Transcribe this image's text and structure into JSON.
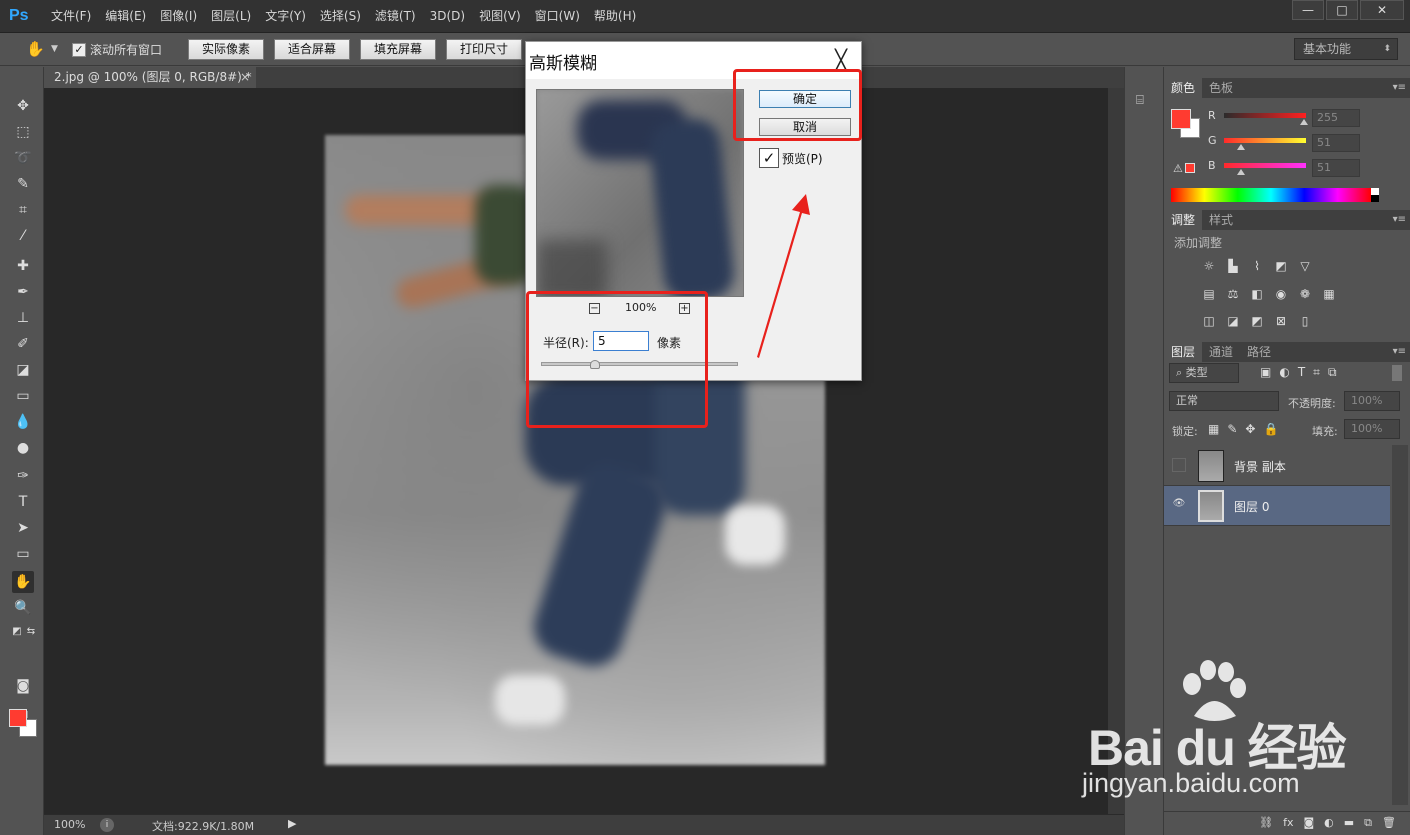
{
  "app": {
    "logo": "Ps",
    "menu": [
      "文件(F)",
      "编辑(E)",
      "图像(I)",
      "图层(L)",
      "文字(Y)",
      "选择(S)",
      "滤镜(T)",
      "3D(D)",
      "视图(V)",
      "窗口(W)",
      "帮助(H)"
    ],
    "window_controls": {
      "minimize": "—",
      "maximize": "□",
      "close": "✕"
    }
  },
  "options_bar": {
    "scroll_all_windows_label": "滚动所有窗口",
    "scroll_all_checked": true,
    "buttons": [
      "实际像素",
      "适合屏幕",
      "填充屏幕",
      "打印尺寸"
    ],
    "workspace": "基本功能"
  },
  "document": {
    "tab_title": "2.jpg @ 100% (图层 0, RGB/8#) *",
    "tab_close": "×",
    "zoom": "100%",
    "doc_info": "文档:922.9K/1.80M",
    "status_arrow": "▶"
  },
  "toolbar": {
    "icons": [
      "move-icon",
      "marquee-icon",
      "lasso-icon",
      "quick-select-icon",
      "crop-icon",
      "eyedropper-icon",
      "healing-brush-icon",
      "brush-icon",
      "clone-stamp-icon",
      "history-brush-icon",
      "eraser-icon",
      "gradient-icon",
      "blur-icon",
      "dodge-icon",
      "pen-icon",
      "type-icon",
      "path-select-icon",
      "rectangle-icon",
      "hand-icon",
      "zoom-icon"
    ],
    "active": "hand-icon",
    "foreground_color": "#ff3b30",
    "background_color": "#ffffff"
  },
  "color_panel": {
    "tabs": [
      "颜色",
      "色板"
    ],
    "r": {
      "label": "R",
      "value": "255"
    },
    "g": {
      "label": "G",
      "value": "51"
    },
    "b": {
      "label": "B",
      "value": "51"
    }
  },
  "adjustments_panel": {
    "tabs": [
      "调整",
      "样式"
    ],
    "add_label": "添加调整"
  },
  "layers_panel": {
    "tabs": [
      "图层",
      "通道",
      "路径"
    ],
    "filter_kind": "类型",
    "blend_mode": "正常",
    "opacity_label": "不透明度:",
    "opacity_value": "100%",
    "lock_label": "锁定:",
    "fill_label": "填充:",
    "fill_value": "100%",
    "layers": [
      {
        "name": "背景 副本",
        "visible": false,
        "selected": false
      },
      {
        "name": "图层 0",
        "visible": true,
        "selected": true
      }
    ]
  },
  "dialog": {
    "title": "高斯模糊",
    "close": "╳",
    "ok": "确定",
    "cancel": "取消",
    "preview_label": "预览(P)",
    "preview_checked": true,
    "zoom_out": "−",
    "zoom_in": "+",
    "zoom_value": "100%",
    "radius_label": "半径(R):",
    "radius_value": "5",
    "radius_unit": "像素"
  },
  "watermark": {
    "brand": "Bai du 经验",
    "url": "jingyan.baidu.com"
  },
  "colors": {
    "annotation_red": "#e8211c",
    "selection_blue": "#596883",
    "ps_blue": "#31a8ff"
  }
}
